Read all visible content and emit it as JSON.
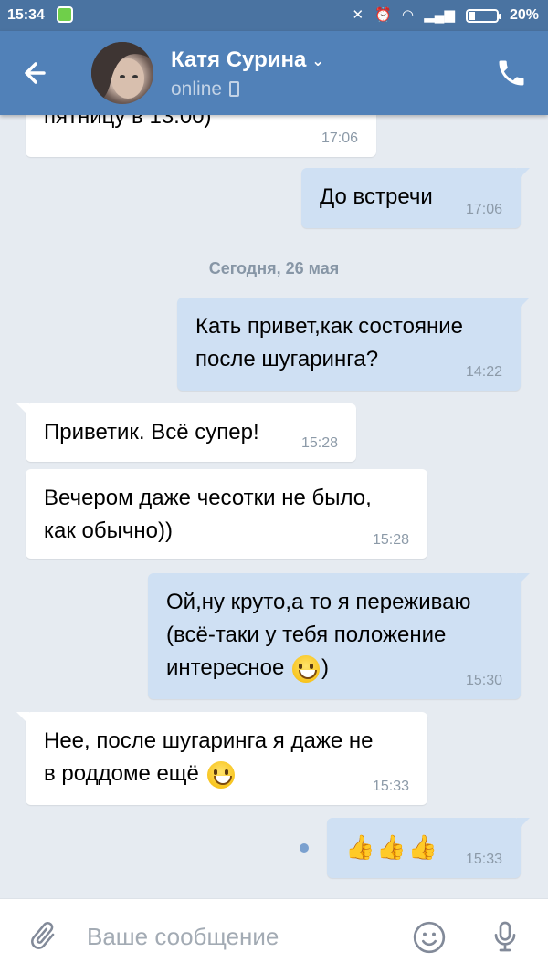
{
  "status_bar": {
    "time": "15:34",
    "battery": "20%"
  },
  "header": {
    "contact_name": "Катя Сурина",
    "status": "online"
  },
  "date_separator": "Сегодня, 26 мая",
  "messages": [
    {
      "direction": "in",
      "text": "пятницу в 13.00)",
      "time": "17:06"
    },
    {
      "direction": "out",
      "text": "До встречи",
      "time": "17:06"
    },
    {
      "direction": "out",
      "text": "Кать привет,как состояние\nпосле шугаринга?",
      "time": "14:22"
    },
    {
      "direction": "in",
      "text": "Приветик. Всё супер!",
      "time": "15:28"
    },
    {
      "direction": "in",
      "text": "Вечером даже чесотки не было,\nкак обычно))",
      "time": "15:28"
    },
    {
      "direction": "out",
      "text_1": "Ой,ну круто,а то я переживаю\n(всё-таки у тебя положение\nинтересное ",
      "emoji": "grinning-emoji",
      "text_2": ")",
      "time": "15:30"
    },
    {
      "direction": "in",
      "text": "Нее, после шугаринга я даже не\nв роддоме ещё ",
      "emoji": "smiley-emoji",
      "time": "15:33"
    },
    {
      "direction": "out",
      "emojis": [
        "thumbs-up",
        "thumbs-up",
        "thumbs-up"
      ],
      "glyph": "👍👍👍",
      "time": "15:33"
    }
  ],
  "input": {
    "placeholder": "Ваше сообщение"
  },
  "colors": {
    "header": "#5181b8",
    "status_bar": "#4a73a1",
    "outgoing": "#cfe0f3",
    "incoming": "#ffffff",
    "background": "#e6ebf1"
  }
}
